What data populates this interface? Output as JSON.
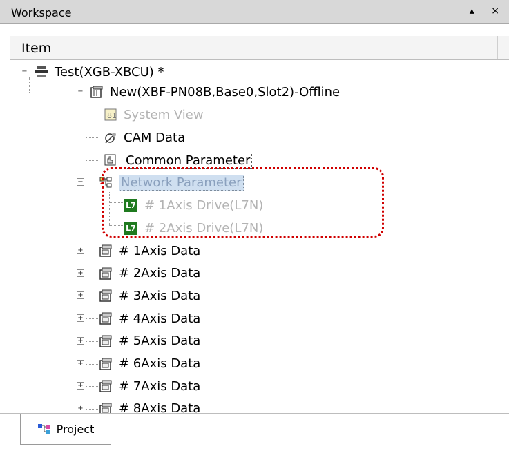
{
  "panel": {
    "title": "Workspace",
    "controls": "▴ ×"
  },
  "column_header": "Item",
  "tree": {
    "root": "Test(XGB-XBCU) *",
    "module": "New(XBF-PN08B,Base0,Slot2)-Offline",
    "system_view": "System View",
    "cam_data": "CAM Data",
    "common_parameter": "Common Parameter",
    "network_parameter": "Network Parameter",
    "drive1": "# 1Axis Drive(L7N)",
    "drive2": "# 2Axis Drive(L7N)",
    "drive_badge": "L7",
    "axis_data": [
      "# 1Axis Data",
      "# 2Axis Data",
      "# 3Axis Data",
      "# 4Axis Data",
      "# 5Axis Data",
      "# 6Axis Data",
      "# 7Axis Data",
      "# 8Axis Data"
    ]
  },
  "tab": {
    "label": "Project"
  },
  "colors": {
    "highlight": "#d00000",
    "drive_badge": "#1f7a1f"
  }
}
